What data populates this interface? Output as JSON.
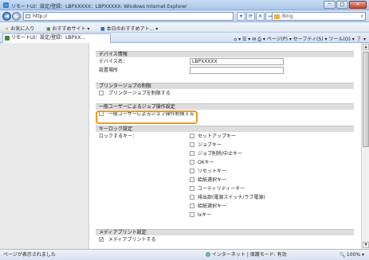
{
  "window": {
    "title": "リモートUI：設定/登録：LBPXXXXX：LBPXXXXX- Windows Internet Explorer",
    "minimize": "─",
    "maximize": "□",
    "close": "✕"
  },
  "address": {
    "url": "http://",
    "search_placeholder": "Bing",
    "refresh_icon": "⟳",
    "stop_icon": "✕",
    "go_icon": "→"
  },
  "favorites": {
    "favorites_label": "お気に入り",
    "suggested_label": "おすすめサイト ▾",
    "today_label": "本日のおすすめアト... ▾"
  },
  "tab": {
    "title": "リモートUI：設定/登録：LBPXX...",
    "commands": "⌂ ▾  ☰ ▾  ✉  ⎙ ▾  ページ(P) ▾  セーフティ(S) ▾  ツール(O) ▾  ❓ ▾"
  },
  "device_info": {
    "header": "デバイス情報",
    "name_label": "デバイス名：",
    "name_value": "LBPXXXXX",
    "location_label": "設置場所"
  },
  "printer_job_restrict": {
    "header": "プリンタージョブの制限",
    "option_label": "プリンタージョブを制限する",
    "checked": false
  },
  "general_user_ops": {
    "header": "一般ユーザーによるジョブ操作設定",
    "option_label": "一般ユーザーによるジョブ操作制限する",
    "checked": false
  },
  "key_lock": {
    "header": "キーロック設定",
    "row_label": "ロックするキー：",
    "keys": [
      {
        "label": "セットアップキー",
        "checked": false
      },
      {
        "label": "ジョブキー",
        "checked": false
      },
      {
        "label": "ジョブ削除/中止キー",
        "checked": false
      },
      {
        "label": "OKキー",
        "checked": false
      },
      {
        "label": "リセットキー",
        "checked": false
      },
      {
        "label": "給紙選択キー",
        "checked": false
      },
      {
        "label": "ユーティリティーキー",
        "checked": false
      },
      {
        "label": "排出部(電源スイッチ/ラブ電源)",
        "checked": false
      },
      {
        "label": "給紙選択キー",
        "checked": false
      },
      {
        "label": "lxキー",
        "checked": false
      }
    ]
  },
  "media_print": {
    "header": "メディアプリント設定",
    "option_label": "メディアプリントする",
    "checked": true
  },
  "status": {
    "left": "ページが表示されました",
    "zone": "インターネット | 保護モード: 有効",
    "zoom": "🔍 100%  ▾"
  }
}
